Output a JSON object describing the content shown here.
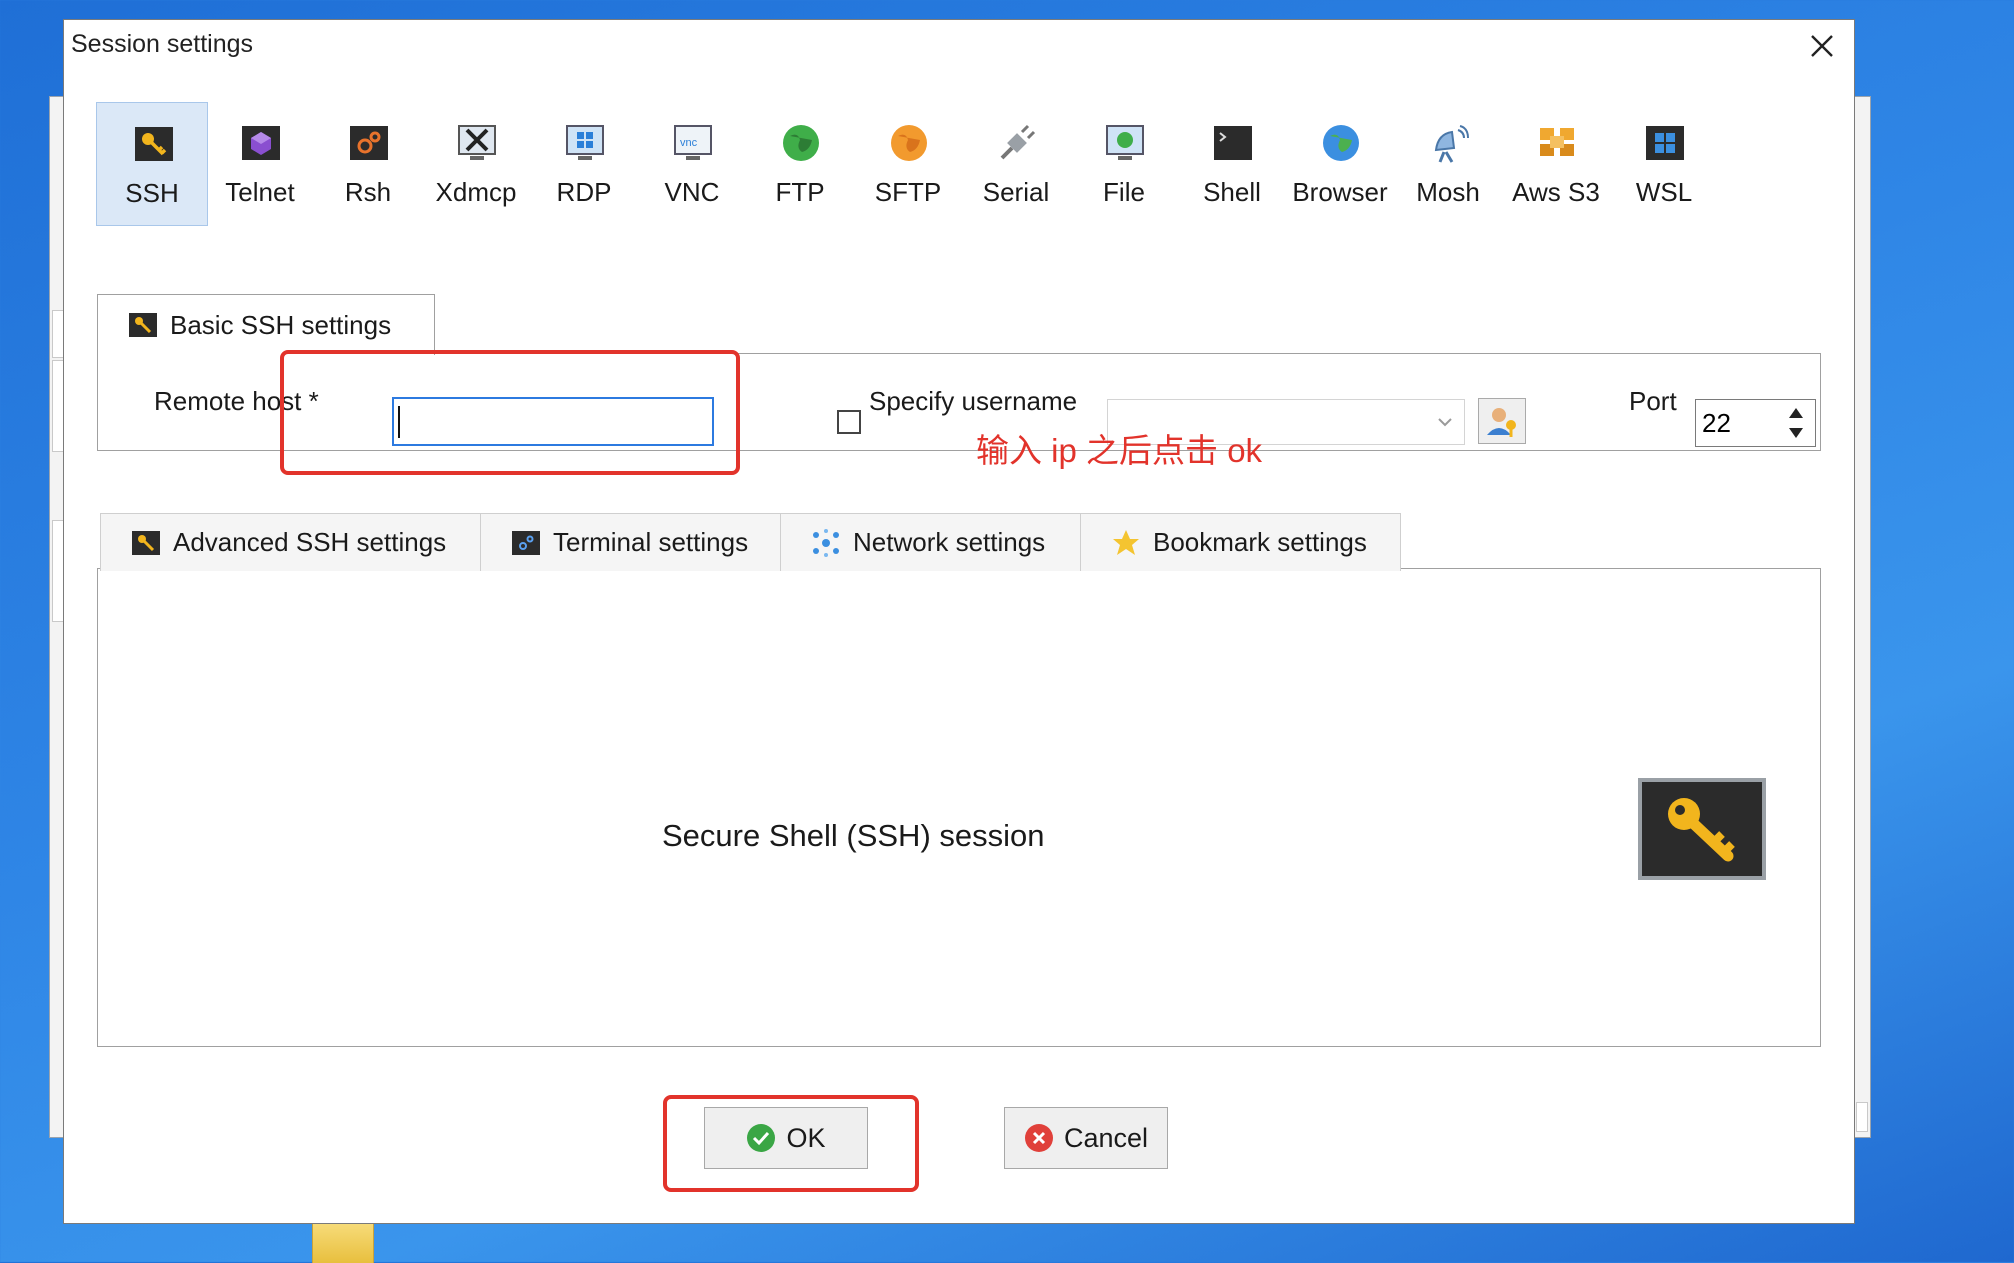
{
  "dialog": {
    "title": "Session settings"
  },
  "session_types": [
    {
      "label": "SSH",
      "icon": "ssh-key-icon",
      "active": true
    },
    {
      "label": "Telnet",
      "icon": "telnet-icon"
    },
    {
      "label": "Rsh",
      "icon": "rsh-icon"
    },
    {
      "label": "Xdmcp",
      "icon": "xdmcp-icon"
    },
    {
      "label": "RDP",
      "icon": "rdp-icon"
    },
    {
      "label": "VNC",
      "icon": "vnc-icon"
    },
    {
      "label": "FTP",
      "icon": "ftp-globe-icon"
    },
    {
      "label": "SFTP",
      "icon": "sftp-globe-icon"
    },
    {
      "label": "Serial",
      "icon": "serial-plug-icon"
    },
    {
      "label": "File",
      "icon": "file-monitor-icon"
    },
    {
      "label": "Shell",
      "icon": "shell-terminal-icon"
    },
    {
      "label": "Browser",
      "icon": "browser-globe-icon"
    },
    {
      "label": "Mosh",
      "icon": "mosh-antenna-icon"
    },
    {
      "label": "Aws S3",
      "icon": "aws-cubes-icon"
    },
    {
      "label": "WSL",
      "icon": "wsl-windows-icon"
    }
  ],
  "basic": {
    "tab_label": "Basic SSH settings",
    "remote_host_label": "Remote host *",
    "remote_host_value": "",
    "specify_username_label": "Specify username",
    "specify_username_checked": false,
    "username_value": "",
    "port_label": "Port",
    "port_value": "22"
  },
  "annotation": {
    "text": "输入 ip 之后点击 ok",
    "color": "#e2332b"
  },
  "advanced_tabs": [
    {
      "label": "Advanced SSH settings",
      "icon": "ssh-key-icon"
    },
    {
      "label": "Terminal settings",
      "icon": "terminal-icon"
    },
    {
      "label": "Network settings",
      "icon": "network-icon"
    },
    {
      "label": "Bookmark settings",
      "icon": "star-icon"
    }
  ],
  "session_description": "Secure Shell (SSH) session",
  "buttons": {
    "ok": "OK",
    "cancel": "Cancel"
  },
  "colors": {
    "accent": "#2c7ae0",
    "active_tab_bg": "#dbe8f7",
    "annotation_red": "#e2332b",
    "ok_green": "#3aa645",
    "cancel_red": "#e0403a"
  }
}
